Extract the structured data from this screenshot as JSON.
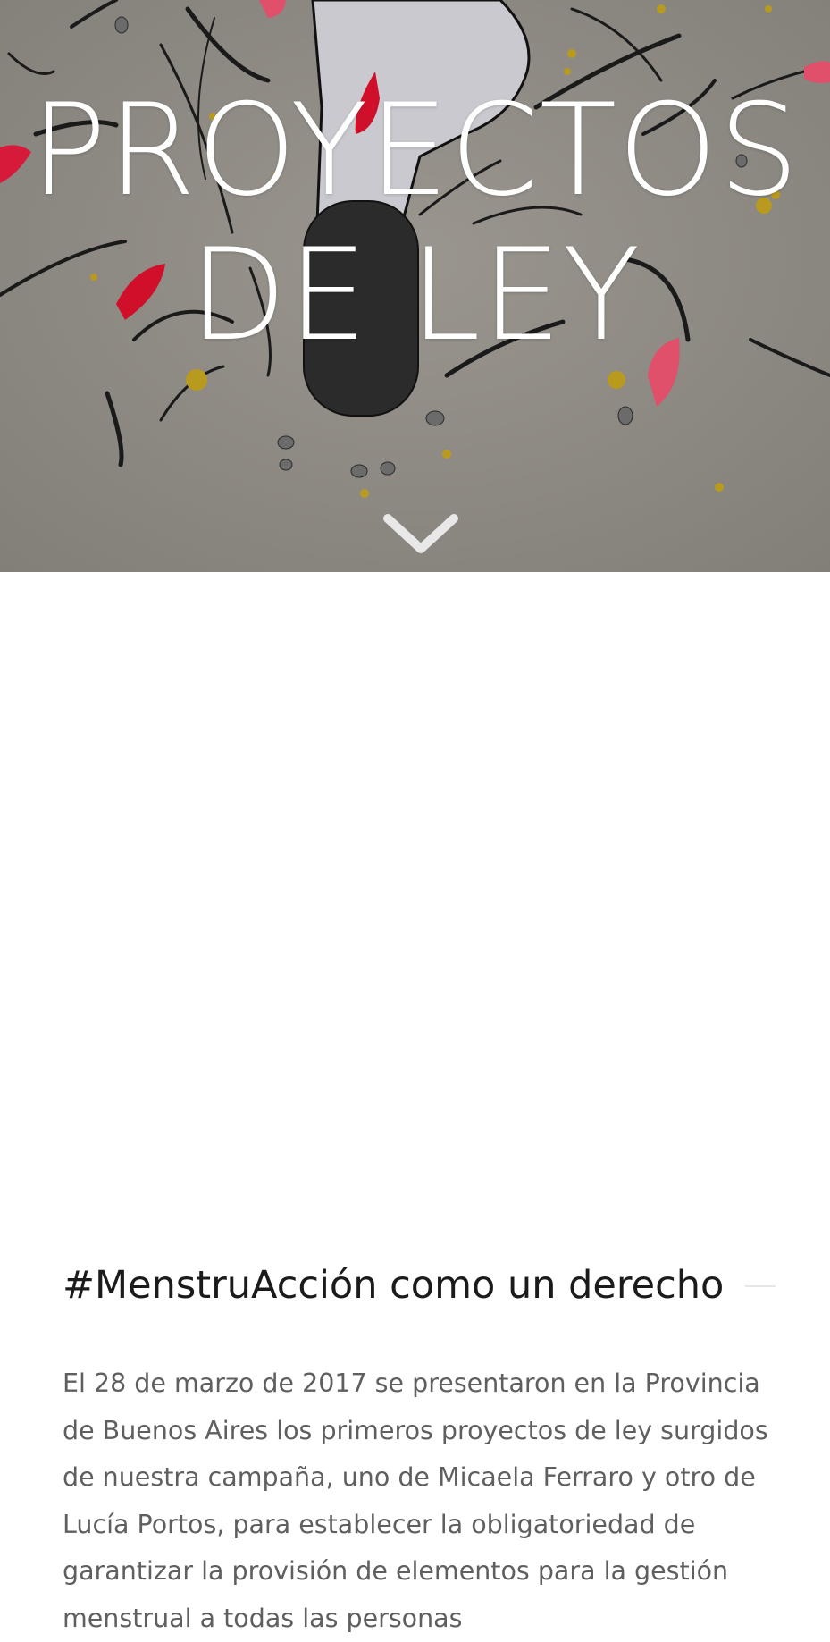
{
  "hero": {
    "title_line1": "PROYECTOS",
    "title_line2": "DE LEY",
    "scroll_icon": "chevron-down-icon",
    "background_color": "#8f8b85",
    "accent_red": "#d0102a",
    "accent_pink": "#e0506a",
    "accent_gold": "#b89a1e"
  },
  "article": {
    "heading": "#MenstruAcción como un derecho",
    "paragraph": "El 28 de marzo de 2017 se presentaron en la Provincia de Buenos Aires los primeros proyectos de ley surgidos de nuestra campaña, uno de Micaela Ferraro y otro de Lucía Portos, para establecer la obligatoriedad de garantizar la provisión de elementos para la gestión menstrual a todas las personas"
  }
}
